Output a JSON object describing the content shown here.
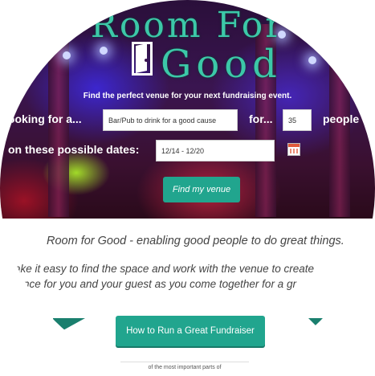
{
  "logo": {
    "line1": "Room For",
    "line2": "Good"
  },
  "search": {
    "tagline": "Find the perfect venue for your next fundraising event.",
    "looking_label": "looking for a...",
    "venue_value": "Bar/Pub to drink for a good cause",
    "for_label": "for...",
    "people_value": "35",
    "people_label": "people",
    "dates_label": "on these possible dates:",
    "dates_value": "12/14 - 12/20",
    "find_button": "Find my venue"
  },
  "content": {
    "headline": "Room for Good - enabling good people to do great things.",
    "para_line1": "ake it easy to find the space and work with the venue to create",
    "para_line2": "rience for you and your guest as you come together for a gr",
    "guide_button": "How to Run a Great Fundraiser",
    "footer_snippet": "of the most important parts of"
  },
  "colors": {
    "accent": "#21a58e",
    "logo": "#3cc8a8"
  }
}
